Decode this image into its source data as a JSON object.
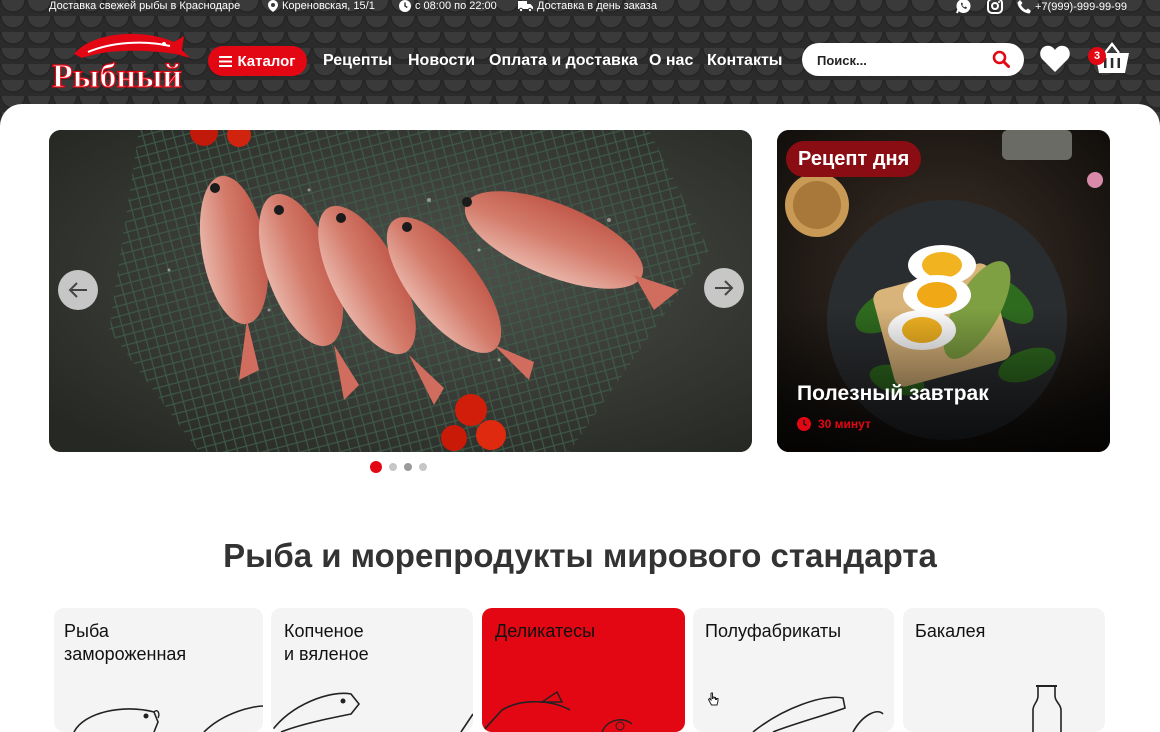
{
  "topbar": {
    "delivery": "Доставка свежей рыбы в Краснодаре",
    "address": "Кореновская, 15/1",
    "hours": "с 08:00 по 22:00",
    "same_day": "Доставка в день заказа",
    "phone": "+7(999)-999-99-99"
  },
  "logo": {
    "text": "Рыбный"
  },
  "nav": {
    "catalog": "Каталог",
    "items": [
      "Рецепты",
      "Новости",
      "Оплата и доставка",
      "О нас",
      "Контакты"
    ]
  },
  "search": {
    "placeholder": "Поиск..."
  },
  "cart": {
    "count": "3"
  },
  "recipe": {
    "badge": "Рецепт дня",
    "title": "Полезный завтрак",
    "time": "30 минут"
  },
  "slider": {
    "slides": 4,
    "active_slide": 1
  },
  "section": {
    "title": "Рыба и морепродукты мирового стандарта"
  },
  "categories": [
    {
      "label": "Рыба\nзамороженная"
    },
    {
      "label": "Копченое\nи вяленое"
    },
    {
      "label": "Деликатесы"
    },
    {
      "label": "Полуфабрикаты"
    },
    {
      "label": "Бакалея"
    }
  ],
  "colors": {
    "accent": "#e30613",
    "header": "#2b2b2b",
    "card": "#f4f4f4"
  }
}
